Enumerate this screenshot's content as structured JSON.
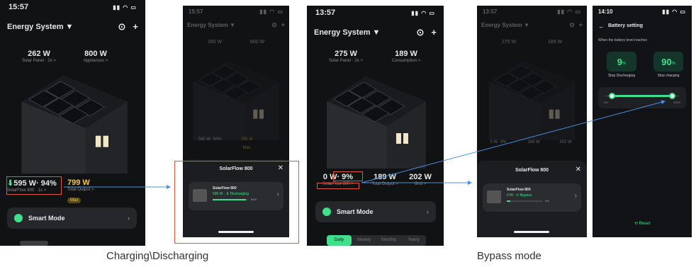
{
  "captions": {
    "left": "Charging\\Discharging",
    "right": "Bypass mode"
  },
  "phone1": {
    "time": "15:57",
    "title": "Energy System ▼",
    "solar_value": "262 W",
    "solar_label": "Solar Panel · 2x >",
    "appliance_value": "800 W",
    "appliance_label": "Appliances >",
    "battery_value": "595 W· 94%",
    "battery_label": "SolarFlow 800 · 1x >",
    "output_value": "799 W",
    "output_label": "Total Output >",
    "output_badge": "Max",
    "smart_mode": "Smart Mode"
  },
  "phone2": {
    "time": "15:57",
    "title": "Energy System ▼",
    "solar_value": "265 W",
    "appliance_value": "800 W",
    "bg_battery": "595 W· 94%",
    "bg_output": "799 W",
    "bg_badge": "Max",
    "sheet_title": "SolarFlow 800",
    "device_name": "SolarFlow 800",
    "device_status": "595 W · ⬇ Discharging",
    "device_percent": "94%"
  },
  "phone3": {
    "time": "13:57",
    "title": "Energy System ▼",
    "solar_value": "275 W",
    "solar_label": "Solar Panel · 2x >",
    "consumption_value": "189 W",
    "consumption_label": "Consumption >",
    "battery_value": "0 W· 9%",
    "battery_label": "SolarFlow 800 >",
    "output_value": "189 W",
    "output_label": "Total Output >",
    "grid_value": "202 W",
    "grid_label": "Grid >",
    "smart_mode": "Smart Mode",
    "tabs": [
      "Daily",
      "Weekly",
      "Monthly",
      "Yearly"
    ]
  },
  "phone4": {
    "time": "13:57",
    "title": "Energy System ▼",
    "solar_value": "275 W",
    "consumption_value": "189 W",
    "bg_battery": "0 W· 9%",
    "bg_output": "189 W",
    "bg_grid": "202 W",
    "sheet_title": "SolarFlow 800",
    "device_name": "SolarFlow 800",
    "device_status": "0 W · ⟳ Bypass",
    "device_percent": "9%"
  },
  "phone5": {
    "time": "14:10",
    "title": "Battery setting",
    "subtitle": "When the battery level reaches",
    "stop_discharging_value": "9",
    "stop_discharging_unit": "%",
    "stop_discharging_label": "Stop Discharging",
    "stop_charging_value": "90",
    "stop_charging_unit": "%",
    "stop_charging_label": "Stop charging",
    "slider_min_label": "0%",
    "slider_max_label": "100%",
    "slider_low": 0.09,
    "slider_high": 0.9,
    "reset_label": "⟲ Reset"
  },
  "colors": {
    "accent_green": "#3ee08a",
    "highlight_red": "#e0563f",
    "arrow_blue": "#4a90e2",
    "output_yellow": "#f2c94c"
  }
}
